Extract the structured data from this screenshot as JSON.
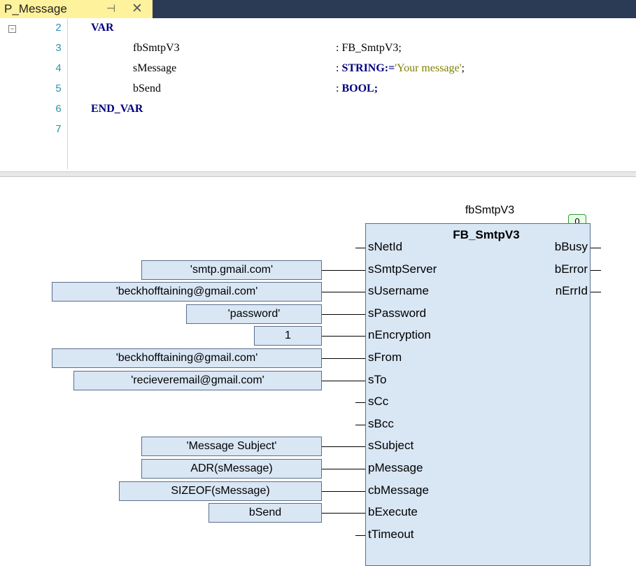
{
  "tab": {
    "title": "P_Message",
    "pin_icon": "⊣",
    "close_icon": "✕"
  },
  "declaration": {
    "lines": [
      {
        "num": "2",
        "code": [
          {
            "t": "VAR",
            "c": "kw"
          }
        ]
      },
      {
        "num": "3",
        "code": [
          {
            "t": "fbSmtpV3",
            "c": "plain",
            "indent": 1
          }
        ],
        "rhs": [
          {
            "t": ":",
            "c": "plain"
          },
          {
            "t": " FB_SmtpV3;",
            "c": "plain"
          }
        ]
      },
      {
        "num": "4",
        "code": [
          {
            "t": "sMessage",
            "c": "plain",
            "indent": 1
          }
        ],
        "rhs": [
          {
            "t": ":",
            "c": "plain"
          },
          {
            "t": " STRING:=",
            "c": "kw"
          },
          {
            "t": "'Your message'",
            "c": "str"
          },
          {
            "t": ";",
            "c": "plain"
          }
        ]
      },
      {
        "num": "5",
        "code": [
          {
            "t": "bSend",
            "c": "plain",
            "indent": 1
          }
        ],
        "rhs": [
          {
            "t": ":",
            "c": "plain"
          },
          {
            "t": " BOOL;",
            "c": "kw"
          }
        ]
      },
      {
        "num": "6",
        "code": [
          {
            "t": "END_VAR",
            "c": "kw"
          }
        ]
      },
      {
        "num": "7",
        "code": []
      }
    ]
  },
  "fbd": {
    "instance_name": "fbSmtpV3",
    "type_name": "FB_SmtpV3",
    "exec_order": "0",
    "inputs": [
      {
        "pin": "sNetId",
        "value": ""
      },
      {
        "pin": "sSmtpServer",
        "value": "'smtp.gmail.com'"
      },
      {
        "pin": "sUsername",
        "value": "'beckhofftaining@gmail.com'"
      },
      {
        "pin": "sPassword",
        "value": "'password'"
      },
      {
        "pin": "nEncryption",
        "value": "1"
      },
      {
        "pin": "sFrom",
        "value": "'beckhofftaining@gmail.com'"
      },
      {
        "pin": "sTo",
        "value": "'recieveremail@gmail.com'"
      },
      {
        "pin": "sCc",
        "value": ""
      },
      {
        "pin": "sBcc",
        "value": ""
      },
      {
        "pin": "sSubject",
        "value": "'Message Subject'"
      },
      {
        "pin": "pMessage",
        "value": "ADR(sMessage)"
      },
      {
        "pin": "cbMessage",
        "value": "SIZEOF(sMessage)"
      },
      {
        "pin": "bExecute",
        "value": "bSend"
      },
      {
        "pin": "tTimeout",
        "value": ""
      }
    ],
    "outputs": [
      {
        "pin": "bBusy"
      },
      {
        "pin": "bError"
      },
      {
        "pin": "nErrId"
      }
    ]
  }
}
